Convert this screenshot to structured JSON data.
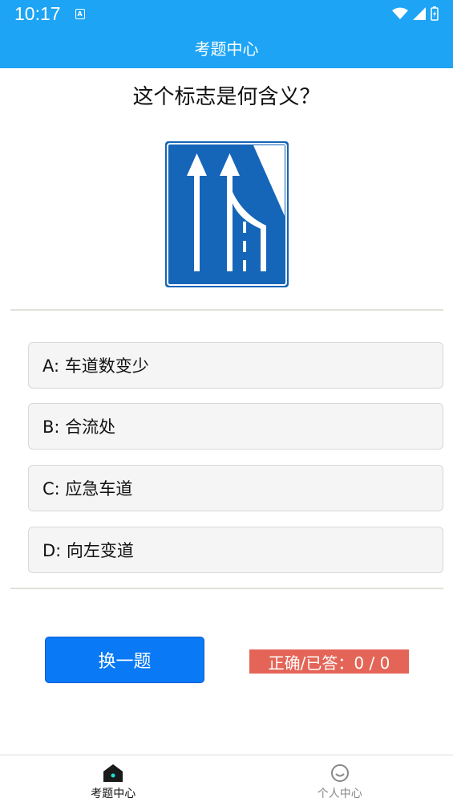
{
  "status_bar": {
    "time": "10:17"
  },
  "app_bar": {
    "title": "考题中心"
  },
  "question": {
    "text": "这个标志是何含义？"
  },
  "options": [
    {
      "label": "A: 车道数变少"
    },
    {
      "label": "B: 合流处"
    },
    {
      "label": "C: 应急车道"
    },
    {
      "label": "D: 向左变道"
    }
  ],
  "actions": {
    "next_label": "换一题"
  },
  "score": {
    "text": "正确/已答：0 / 0"
  },
  "bottom_nav": {
    "items": [
      {
        "label": "考题中心",
        "icon": "home-icon",
        "active": true
      },
      {
        "label": "个人中心",
        "icon": "smiley-icon",
        "active": false
      }
    ]
  },
  "colors": {
    "primary": "#1da4f5",
    "button": "#0a79f5",
    "score_bg": "#e46557",
    "sign_blue": "#1565b8"
  }
}
